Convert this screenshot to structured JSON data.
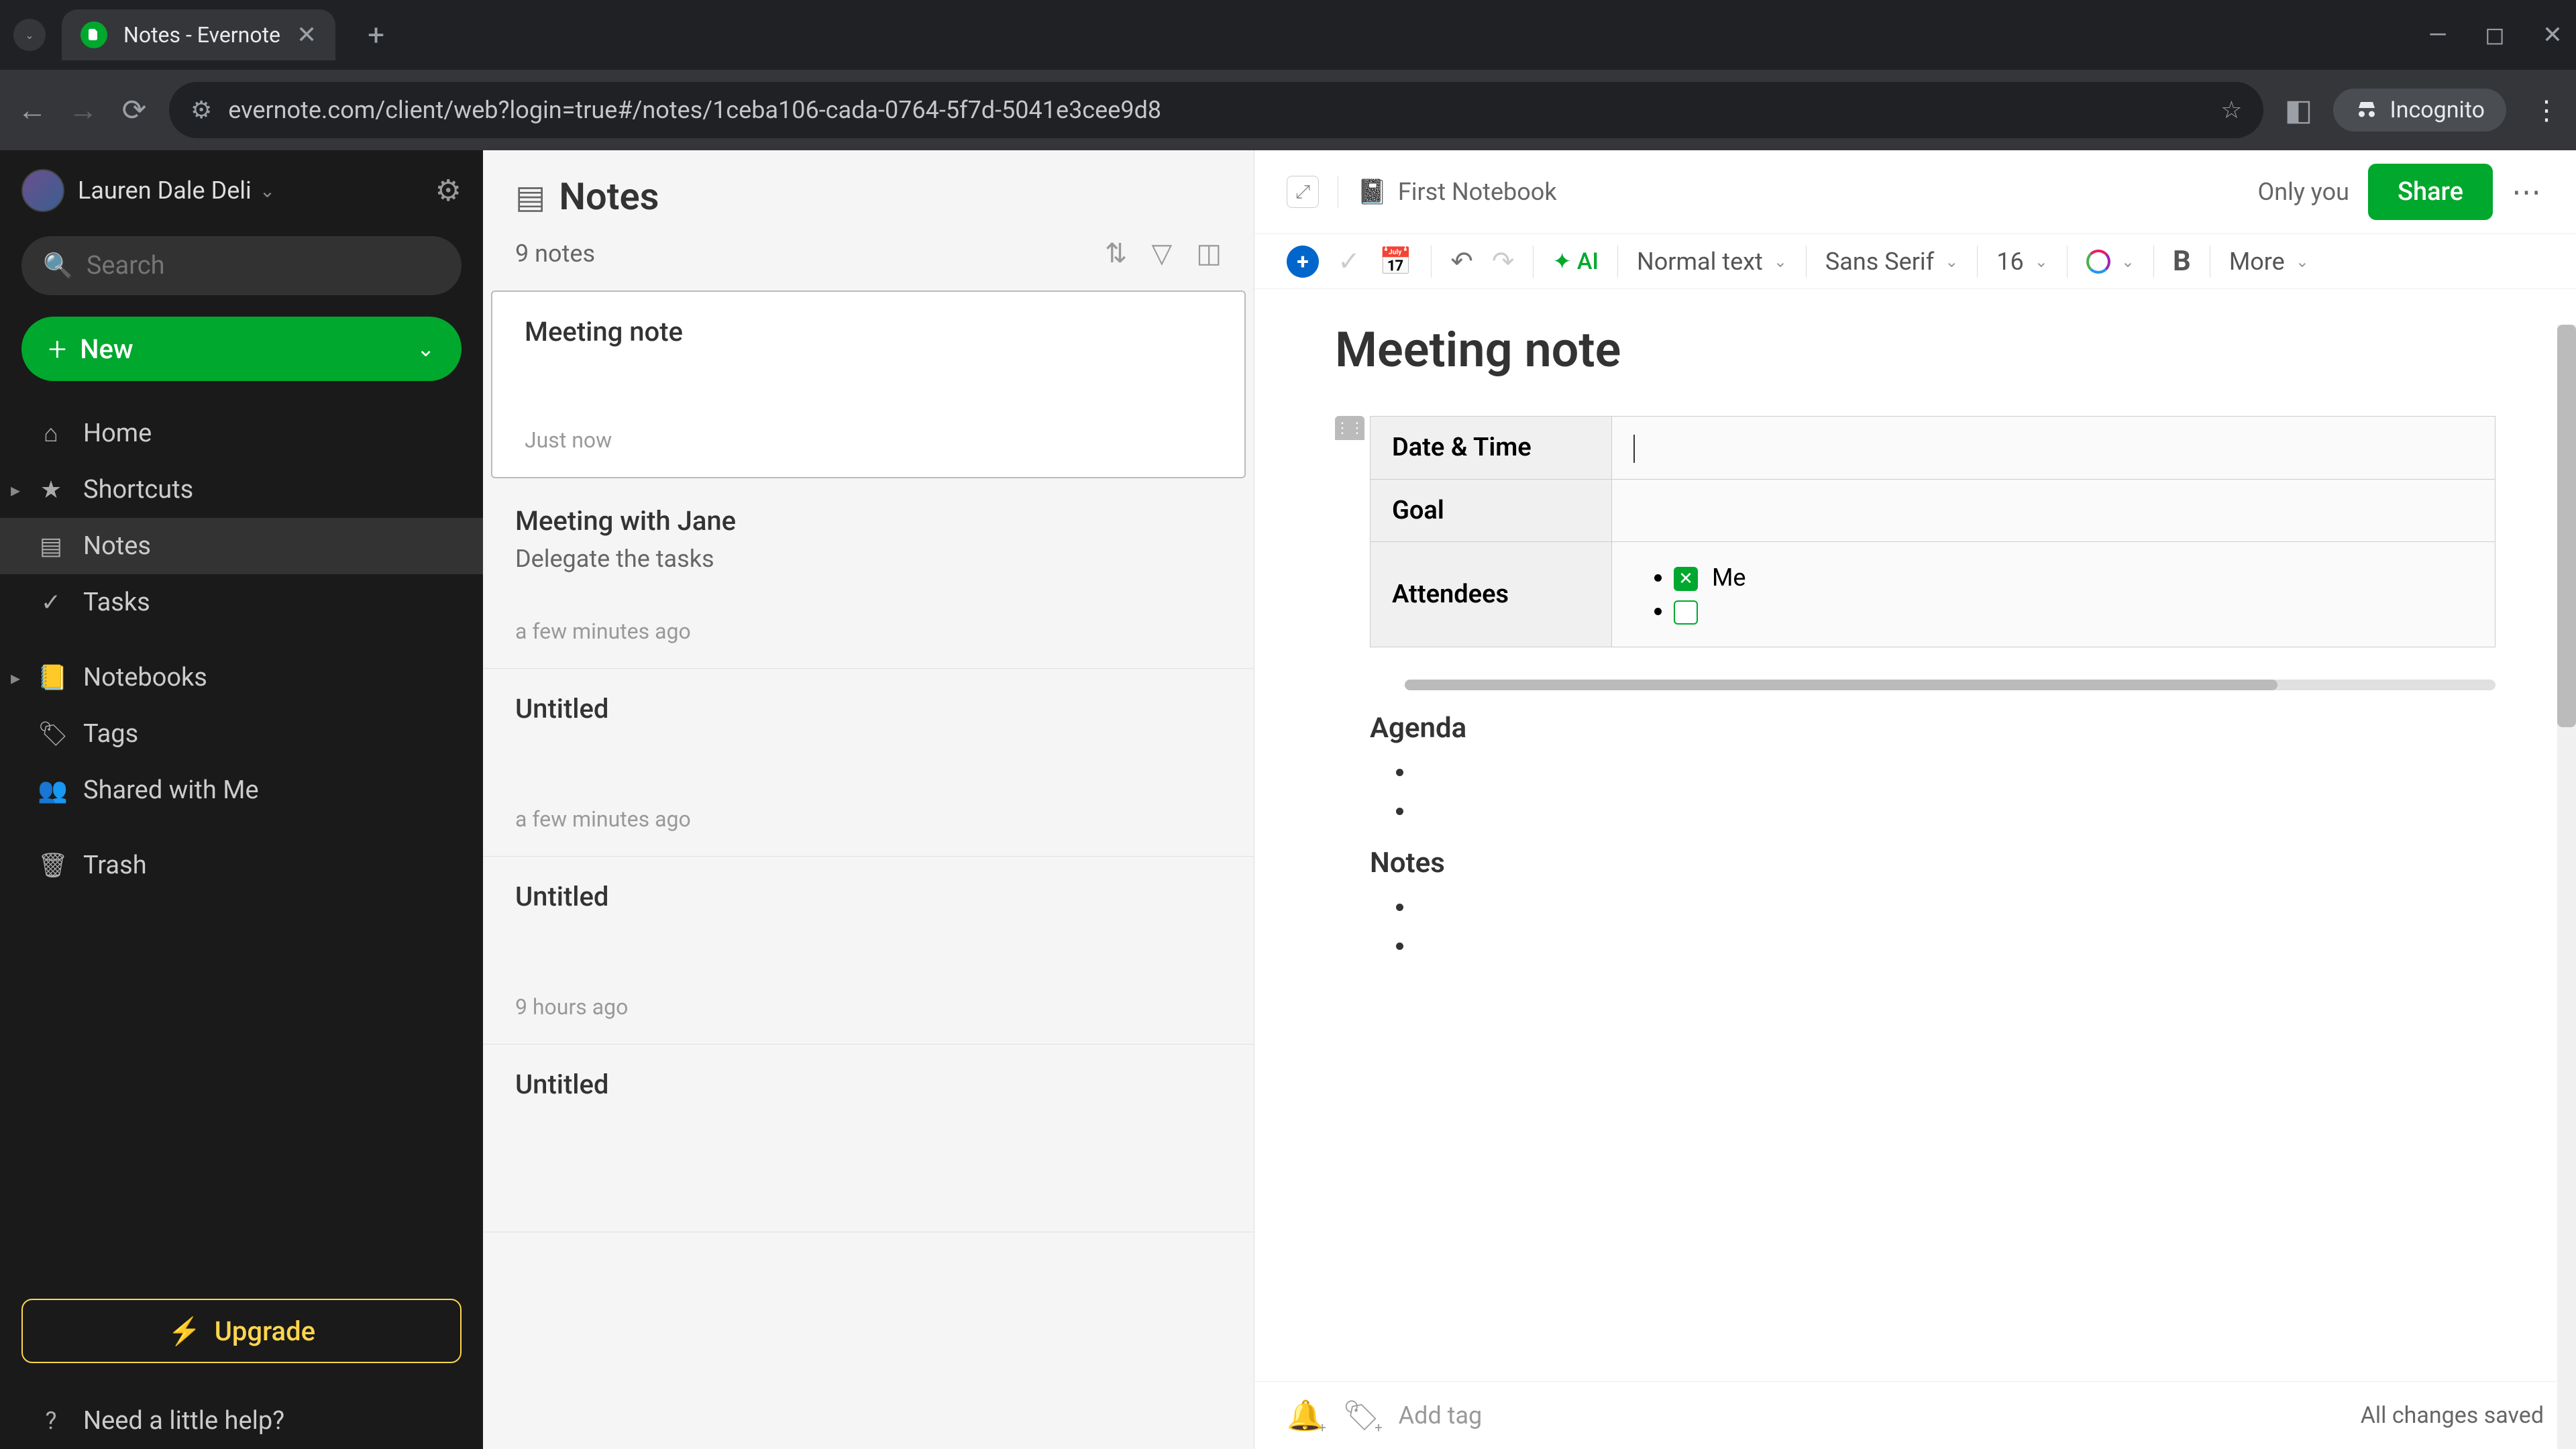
{
  "browser": {
    "tab_title": "Notes - Evernote",
    "url": "evernote.com/client/web?login=true#/notes/1ceba106-cada-0764-5f7d-5041e3cee9d8",
    "incognito_label": "Incognito"
  },
  "sidebar": {
    "username": "Lauren Dale Deli",
    "search_placeholder": "Search",
    "new_button": "New",
    "items": [
      {
        "label": "Home",
        "icon": "⌂"
      },
      {
        "label": "Shortcuts",
        "icon": "★",
        "expandable": true
      },
      {
        "label": "Notes",
        "icon": "▤",
        "active": true
      },
      {
        "label": "Tasks",
        "icon": "✓"
      },
      {
        "label": "Notebooks",
        "icon": "📒",
        "expandable": true
      },
      {
        "label": "Tags",
        "icon": "🏷"
      },
      {
        "label": "Shared with Me",
        "icon": "👥"
      },
      {
        "label": "Trash",
        "icon": "🗑"
      }
    ],
    "upgrade": "Upgrade",
    "help": "Need a little help?"
  },
  "notelist": {
    "title": "Notes",
    "count": "9 notes",
    "items": [
      {
        "title": "Meeting note",
        "preview": "",
        "time": "Just now",
        "selected": true
      },
      {
        "title": "Meeting with Jane",
        "preview": "Delegate the tasks",
        "time": "a few minutes ago"
      },
      {
        "title": "Untitled",
        "preview": "",
        "time": "a few minutes ago"
      },
      {
        "title": "Untitled",
        "preview": "",
        "time": "9 hours ago"
      },
      {
        "title": "Untitled",
        "preview": "",
        "time": ""
      }
    ]
  },
  "editor": {
    "notebook": "First Notebook",
    "only_you": "Only you",
    "share": "Share",
    "toolbar": {
      "ai": "AI",
      "style": "Normal text",
      "font": "Sans Serif",
      "size": "16",
      "more": "More"
    },
    "title": "Meeting note",
    "meta": {
      "date_label": "Date & Time",
      "date_value": "",
      "goal_label": "Goal",
      "goal_value": "",
      "attendees_label": "Attendees",
      "attendee_me": "Me"
    },
    "sections": {
      "agenda": "Agenda",
      "notes": "Notes"
    },
    "footer": {
      "add_tag": "Add tag",
      "status": "All changes saved"
    }
  }
}
